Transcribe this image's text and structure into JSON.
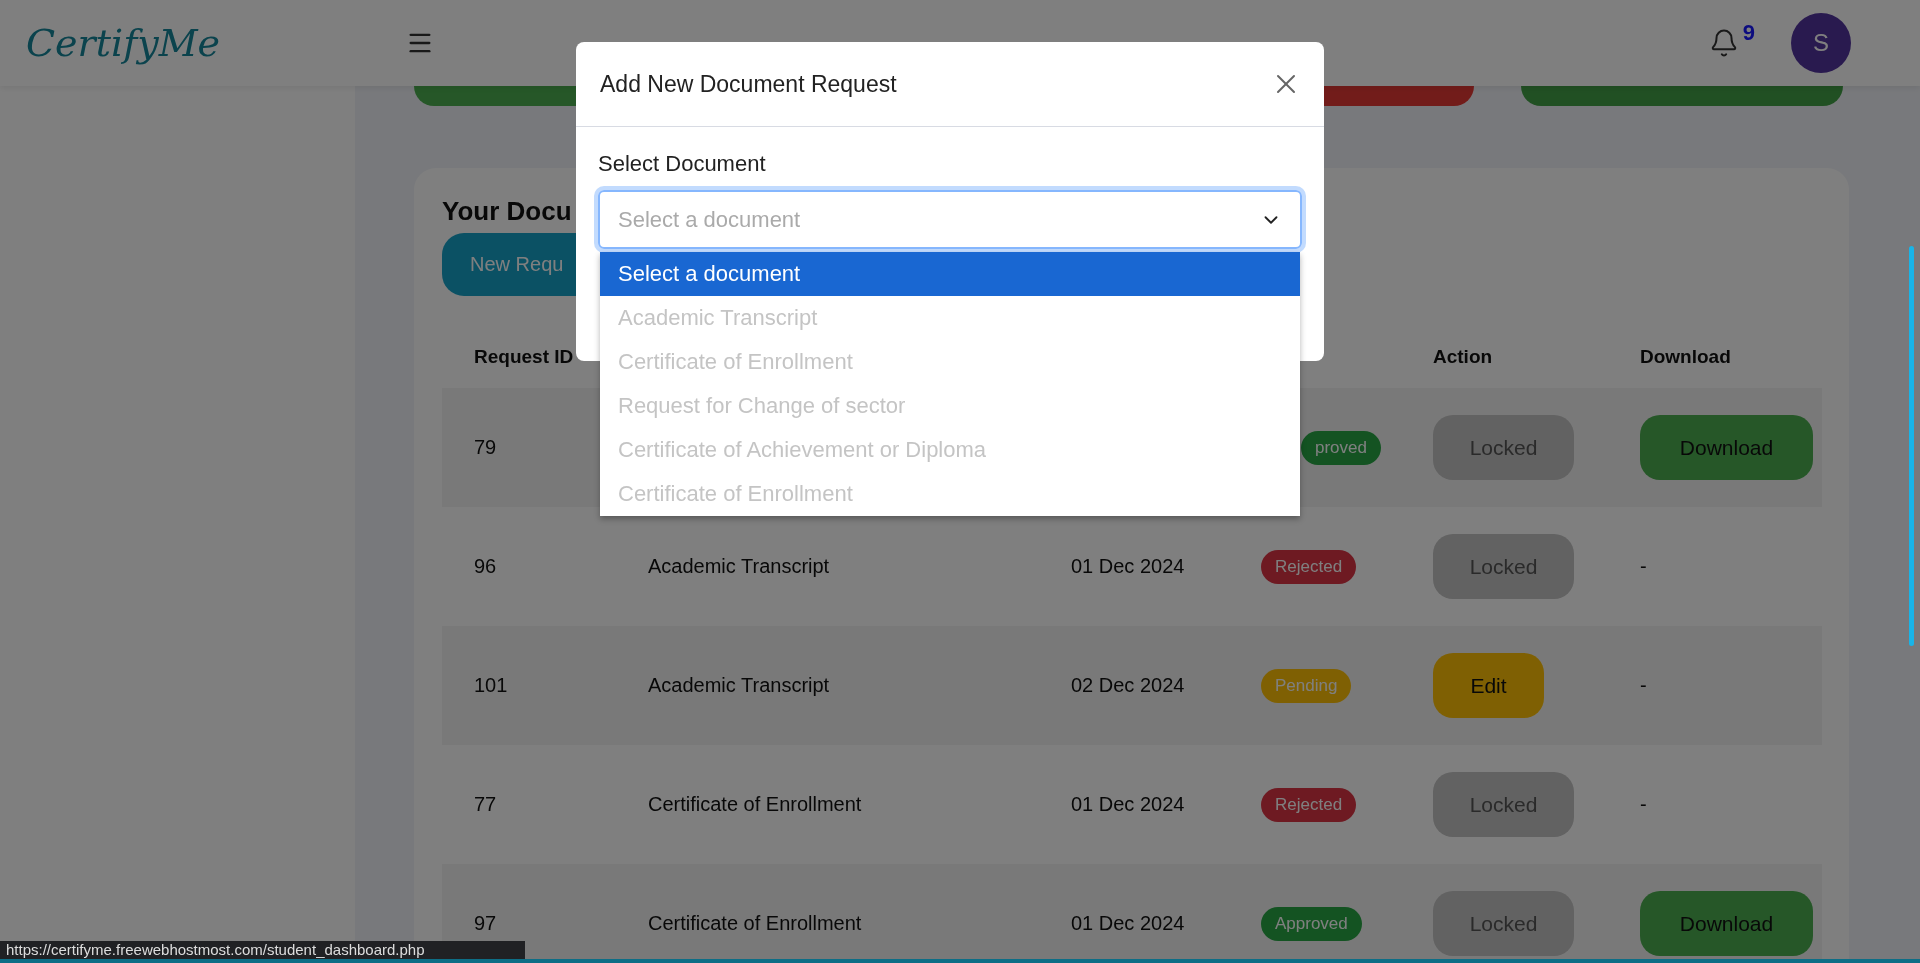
{
  "header": {
    "logo": "CertifyMe",
    "notification_count": "9",
    "avatar_initial": "S"
  },
  "documents_card": {
    "title": "Your Docu",
    "new_request_button": "New Requ",
    "columns": {
      "request_id": "Request ID",
      "action": "Action",
      "download": "Download"
    },
    "rows": [
      {
        "request_id": "79",
        "status": {
          "label": "proved",
          "kind": "approved"
        },
        "action": {
          "label": "Locked",
          "kind": "locked"
        },
        "download": {
          "label": "Download",
          "kind": "button"
        }
      },
      {
        "request_id": "96",
        "document_name": "Academic Transcript",
        "date": "01 Dec 2024",
        "status": {
          "label": "Rejected",
          "kind": "rejected"
        },
        "action": {
          "label": "Locked",
          "kind": "locked"
        },
        "download": {
          "label": "-",
          "kind": "none"
        }
      },
      {
        "request_id": "101",
        "document_name": "Academic Transcript",
        "date": "02 Dec 2024",
        "status": {
          "label": "Pending",
          "kind": "pending"
        },
        "action": {
          "label": "Edit",
          "kind": "edit"
        },
        "download": {
          "label": "-",
          "kind": "none"
        }
      },
      {
        "request_id": "77",
        "document_name": "Certificate of Enrollment",
        "date": "01 Dec 2024",
        "status": {
          "label": "Rejected",
          "kind": "rejected"
        },
        "action": {
          "label": "Locked",
          "kind": "locked"
        },
        "download": {
          "label": "-",
          "kind": "none"
        }
      },
      {
        "request_id": "97",
        "document_name": "Certificate of Enrollment",
        "date": "01 Dec 2024",
        "status": {
          "label": "Approved",
          "kind": "approved"
        },
        "action": {
          "label": "Locked",
          "kind": "locked"
        },
        "download": {
          "label": "Download",
          "kind": "button"
        }
      }
    ]
  },
  "modal": {
    "title": "Add New Document Request",
    "field_label": "Select Document",
    "select_value": "Select a document",
    "options": [
      {
        "label": "Select a document",
        "selected": true,
        "disabled": false
      },
      {
        "label": "Academic Transcript",
        "selected": false,
        "disabled": true
      },
      {
        "label": "Certificate of Enrollment",
        "selected": false,
        "disabled": true
      },
      {
        "label": "Request for Change of sector",
        "selected": false,
        "disabled": true
      },
      {
        "label": "Certificate of Achievement or Diploma",
        "selected": false,
        "disabled": true
      },
      {
        "label": "Certificate of Enrollment",
        "selected": false,
        "disabled": true
      }
    ]
  },
  "browser_status": "https://certifyme.freewebhostmost.com/student_dashboard.php"
}
